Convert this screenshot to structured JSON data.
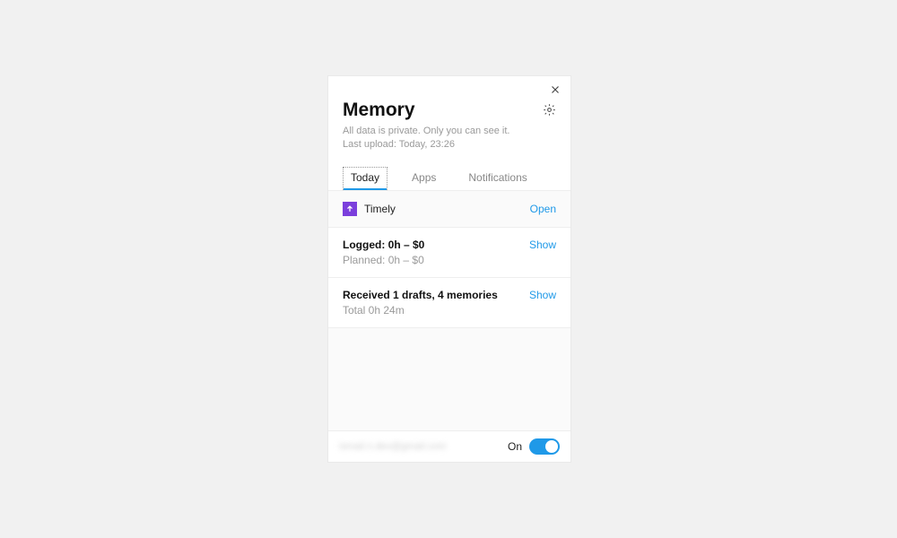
{
  "header": {
    "title": "Memory",
    "privacy_line": "All data is private. Only you can see it.",
    "upload_line": "Last upload: Today, 23:26"
  },
  "tabs": {
    "today": "Today",
    "apps": "Apps",
    "notifications": "Notifications"
  },
  "app_row": {
    "name": "Timely",
    "action": "Open"
  },
  "logged_section": {
    "main": "Logged: 0h – $0",
    "sub": "Planned: 0h – $0",
    "action": "Show"
  },
  "received_section": {
    "main": "Received 1 drafts, 4 memories",
    "sub": "Total 0h 24m",
    "action": "Show"
  },
  "footer": {
    "email": "ismail.n.dev@gmail.com",
    "toggle_label": "On",
    "toggle_state": "on"
  },
  "colors": {
    "accent": "#1f99e8",
    "app_icon": "#7b3fdc"
  }
}
